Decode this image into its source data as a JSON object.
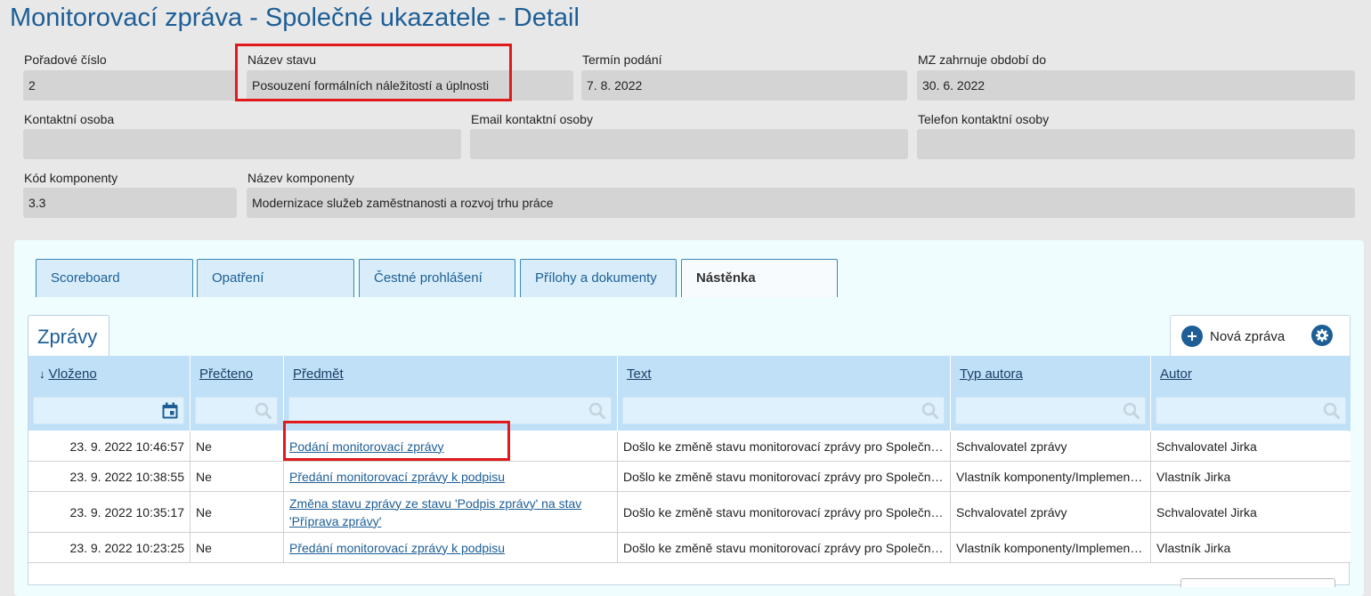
{
  "page": {
    "title": "Monitorovací zpráva - Společné ukazatele - Detail"
  },
  "fields": {
    "poradove_cislo": {
      "label": "Pořadové číslo",
      "value": "2"
    },
    "nazev_stavu": {
      "label": "Název stavu",
      "value": "Posouzení formálních náležitostí a úplnosti"
    },
    "termin_podani": {
      "label": "Termín podání",
      "value": "7. 8. 2022"
    },
    "mz_obdobi": {
      "label": "MZ zahrnuje období do",
      "value": "30. 6. 2022"
    },
    "kontaktni_osoba": {
      "label": "Kontaktní osoba",
      "value": ""
    },
    "email": {
      "label": "Email kontaktní osoby",
      "value": ""
    },
    "telefon": {
      "label": "Telefon kontaktní osoby",
      "value": ""
    },
    "kod_komponenty": {
      "label": "Kód komponenty",
      "value": "3.3"
    },
    "nazev_komponenty": {
      "label": "Název komponenty",
      "value": "Modernizace služeb zaměstnanosti a rozvoj trhu práce"
    }
  },
  "tabs": [
    {
      "label": "Scoreboard",
      "active": false
    },
    {
      "label": "Opatření",
      "active": false
    },
    {
      "label": "Čestné prohlášení",
      "active": false
    },
    {
      "label": "Přílohy a dokumenty",
      "active": false
    },
    {
      "label": "Nástěnka",
      "active": true
    }
  ],
  "subtab": {
    "label": "Zprávy"
  },
  "toolbar": {
    "new_message_label": "Nová zpráva"
  },
  "grid": {
    "columns": [
      {
        "label": "Vloženo",
        "sorted": "desc"
      },
      {
        "label": "Přečteno"
      },
      {
        "label": "Předmět"
      },
      {
        "label": "Text"
      },
      {
        "label": "Typ autora"
      },
      {
        "label": "Autor"
      }
    ],
    "rows": [
      {
        "vlozeno": "23. 9. 2022 10:46:57",
        "precteno": "Ne",
        "predmet": "Podání monitorovací zprávy",
        "text": "Došlo ke změně stavu monitorovací zprávy pro Společné ukazatele",
        "typ_autora": "Schvalovatel zprávy",
        "autor": "Schvalovatel Jirka"
      },
      {
        "vlozeno": "23. 9. 2022 10:38:55",
        "precteno": "Ne",
        "predmet": "Předání monitorovací zprávy k podpisu",
        "text": "Došlo ke změně stavu monitorovací zprávy pro Společné ukazatele",
        "typ_autora": "Vlastník komponenty/Implementátor",
        "autor": "Vlastník Jirka"
      },
      {
        "vlozeno": "23. 9. 2022 10:35:17",
        "precteno": "Ne",
        "predmet": "Změna stavu zprávy ze stavu 'Podpis zprávy' na stav 'Příprava zprávy'",
        "text": "Došlo ke změně stavu monitorovací zprávy pro Společné ukazatele",
        "typ_autora": "Schvalovatel zprávy",
        "autor": "Schvalovatel Jirka"
      },
      {
        "vlozeno": "23. 9. 2022 10:23:25",
        "precteno": "Ne",
        "predmet": "Předání monitorovací zprávy k podpisu",
        "text": "Došlo ke změně stavu monitorovací zprávy pro Společné ukazatele",
        "typ_autora": "Vlastník komponenty/Implementátor",
        "autor": "Vlastník Jirka"
      }
    ]
  },
  "colors": {
    "accent": "#1d5e96",
    "highlight": "#e0191b",
    "header_bg": "#bfe0f7"
  },
  "icons": {
    "calendar": "calendar-icon",
    "search": "search-icon",
    "plus": "plus-circle-icon",
    "gear": "gear-icon",
    "sort": "arrow-down-icon"
  }
}
